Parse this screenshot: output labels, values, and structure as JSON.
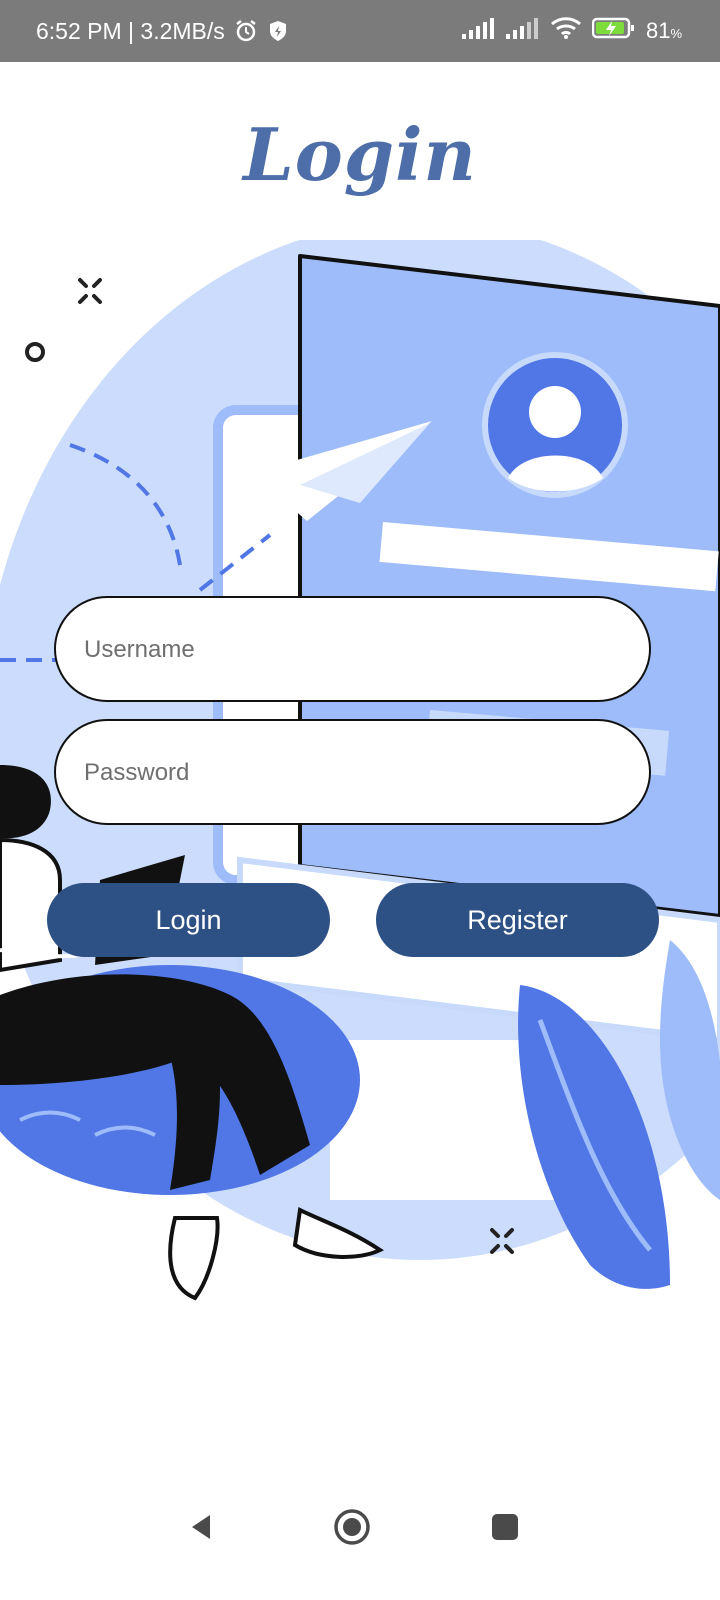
{
  "status_bar": {
    "time_speed": "6:52 PM | 3.2MB/s",
    "battery_percent": "81",
    "battery_unit": "%",
    "icons": [
      "alarm-icon",
      "shield-icon",
      "signal-icon",
      "signal-icon",
      "wifi-icon",
      "battery-charging-icon"
    ]
  },
  "page": {
    "title": "Login"
  },
  "form": {
    "username_placeholder": "Username",
    "password_placeholder": "Password",
    "username_value": "",
    "password_value": ""
  },
  "buttons": {
    "login_label": "Login",
    "register_label": "Register"
  },
  "nav": {
    "icons": [
      "back-icon",
      "home-icon",
      "recents-icon"
    ]
  },
  "colors": {
    "title": "#4d6ea8",
    "button": "#2e5185",
    "illustration_light": "#c8dafc",
    "illustration_mid": "#9dbcf9",
    "illustration_accent": "#5177e6"
  }
}
